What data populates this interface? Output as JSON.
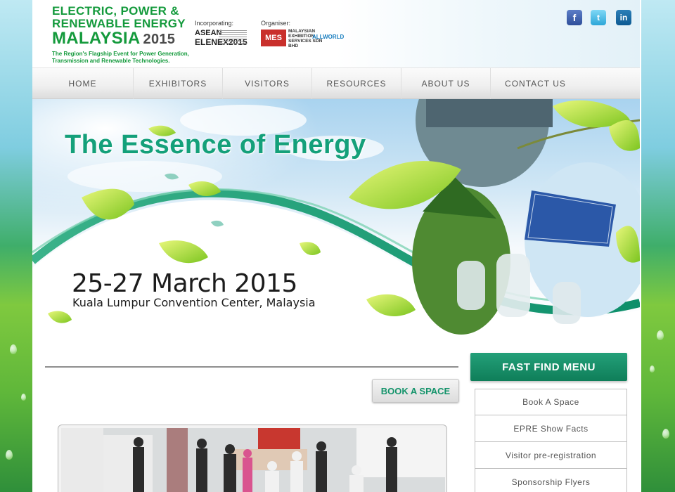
{
  "logo": {
    "line1": "ELECTRIC, POWER &",
    "line2": "RENEWABLE ENERGY",
    "line3": "MALAYSIA",
    "year": "2015",
    "tagline": "The Region's Flagship Event for Power Generation, Transmission and Renewable Technologies."
  },
  "partners": {
    "incorporating_label": "Incorporating:",
    "asean_top": "ASEAN",
    "asean_bottom": "ELENEX2015",
    "organiser_label": "Organiser:",
    "mes_badge": "MES",
    "mes_text": "MALAYSIAN EXHIBITION SERVICES SDN BHD",
    "allworld": "ALLWORLD"
  },
  "social": {
    "facebook": "f",
    "twitter": "t",
    "linkedin": "in"
  },
  "nav": {
    "items": [
      "HOME",
      "EXHIBITORS",
      "VISITORS",
      "RESOURCES",
      "ABOUT US",
      "CONTACT US"
    ]
  },
  "banner": {
    "title": "The Essence of Energy",
    "date": "25-27 March 2015",
    "venue": "Kuala Lumpur Convention Center, Malaysia"
  },
  "content": {
    "book_button": "BOOK A SPACE"
  },
  "fast_find": {
    "heading": "FAST FIND MENU",
    "items": [
      "Book A Space",
      "EPRE Show Facts",
      "Visitor pre-registration",
      "Sponsorship Flyers"
    ]
  },
  "colors": {
    "brand_green": "#149a3c",
    "accent_teal": "#14a07a",
    "menu_green": "#0f7e59"
  }
}
